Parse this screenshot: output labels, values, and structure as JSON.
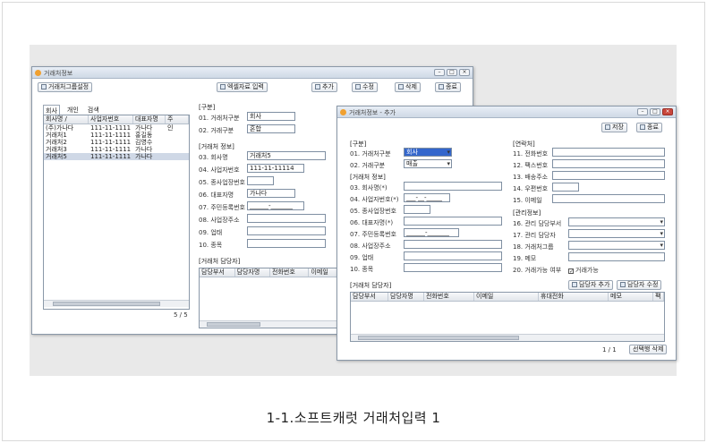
{
  "caption": "1-1.소프트캐럿 거래처입력 1",
  "main_window": {
    "title": "거래처정보",
    "group_button": "거래처그룹설정",
    "excel_button": "엑셀자료 입력",
    "add_button": "추가",
    "edit_button": "수정",
    "delete_button": "삭제",
    "close_button": "종료",
    "tabs": [
      "회사",
      "개인",
      "검색"
    ],
    "list_columns": [
      "회사명 /",
      "사업자번호",
      "대표자명",
      "주"
    ],
    "list_rows": [
      [
        "(주)가나다",
        "111-11-1111",
        "가나다",
        "인"
      ],
      [
        "거래처1",
        "111-11-1111",
        "홍길동",
        ""
      ],
      [
        "거래처2",
        "111-11-1111",
        "김영수",
        ""
      ],
      [
        "거래처3",
        "111-11-1111",
        "가나다",
        ""
      ],
      [
        "거래처5",
        "111-11-1111",
        "가나다",
        ""
      ]
    ],
    "page_count": "5 / 5",
    "section_type": "[구분]",
    "type_labels": [
      "01. 거래처구분",
      "02. 거래구분"
    ],
    "type_values": [
      "회사",
      "혼합"
    ],
    "section_info": "[거래처 정보]",
    "info_labels": [
      "03. 회사명",
      "04. 사업자번호",
      "05. 종사업장번호",
      "06. 대표자명",
      "07. 주민등록번호",
      "08. 사업장주소",
      "09. 업태",
      "10. 종목"
    ],
    "info_values": [
      "거래처5",
      "111-11-11114",
      "",
      "가나다",
      "______-_______",
      "",
      "",
      ""
    ],
    "section_manager": "[거래처 담당자]",
    "manager_columns": [
      "담당부서",
      "담당자명",
      "전화번호",
      "이메일"
    ]
  },
  "dialog": {
    "title": "거래처정보 - 추가",
    "save_button": "저장",
    "close_button": "종료",
    "section_type": "[구분]",
    "type_labels": [
      "01. 거래처구분",
      "02. 거래구분"
    ],
    "type_values": [
      "회사",
      "매출"
    ],
    "section_info": "[거래처 정보]",
    "info_labels": [
      "03. 회사명(*)",
      "04. 사업자번호(*)",
      "05. 종사업장번호",
      "06. 대표자명(*)",
      "07. 주민등록번호",
      "08. 사업장주소",
      "09. 업태",
      "10. 종목"
    ],
    "info_values": [
      "",
      "___-__-_____",
      "",
      "",
      "______-_______",
      "",
      "",
      ""
    ],
    "section_contact": "[연락처]",
    "contact_labels": [
      "11. 전화번호",
      "12. 팩스번호",
      "13. 배송주소",
      "14. 우편번호",
      "15. 이메일"
    ],
    "section_manage": "[관리정보]",
    "manage_labels": [
      "16. 관리 담당부서",
      "17. 관리 담당자",
      "18. 거래처그룹",
      "19. 메모",
      "20. 거래가능 여부"
    ],
    "trade_check_label": "거래가능",
    "section_manager": "[거래처 담당자]",
    "add_manager_button": "담당자 추가",
    "edit_manager_button": "담당자 수정",
    "manager_columns": [
      "담당부서",
      "담당자명",
      "전화번호",
      "이메일",
      "휴대전화",
      "메모",
      "팩"
    ],
    "page_count": "1 / 1",
    "delete_selected_button": "선택행 삭제"
  }
}
